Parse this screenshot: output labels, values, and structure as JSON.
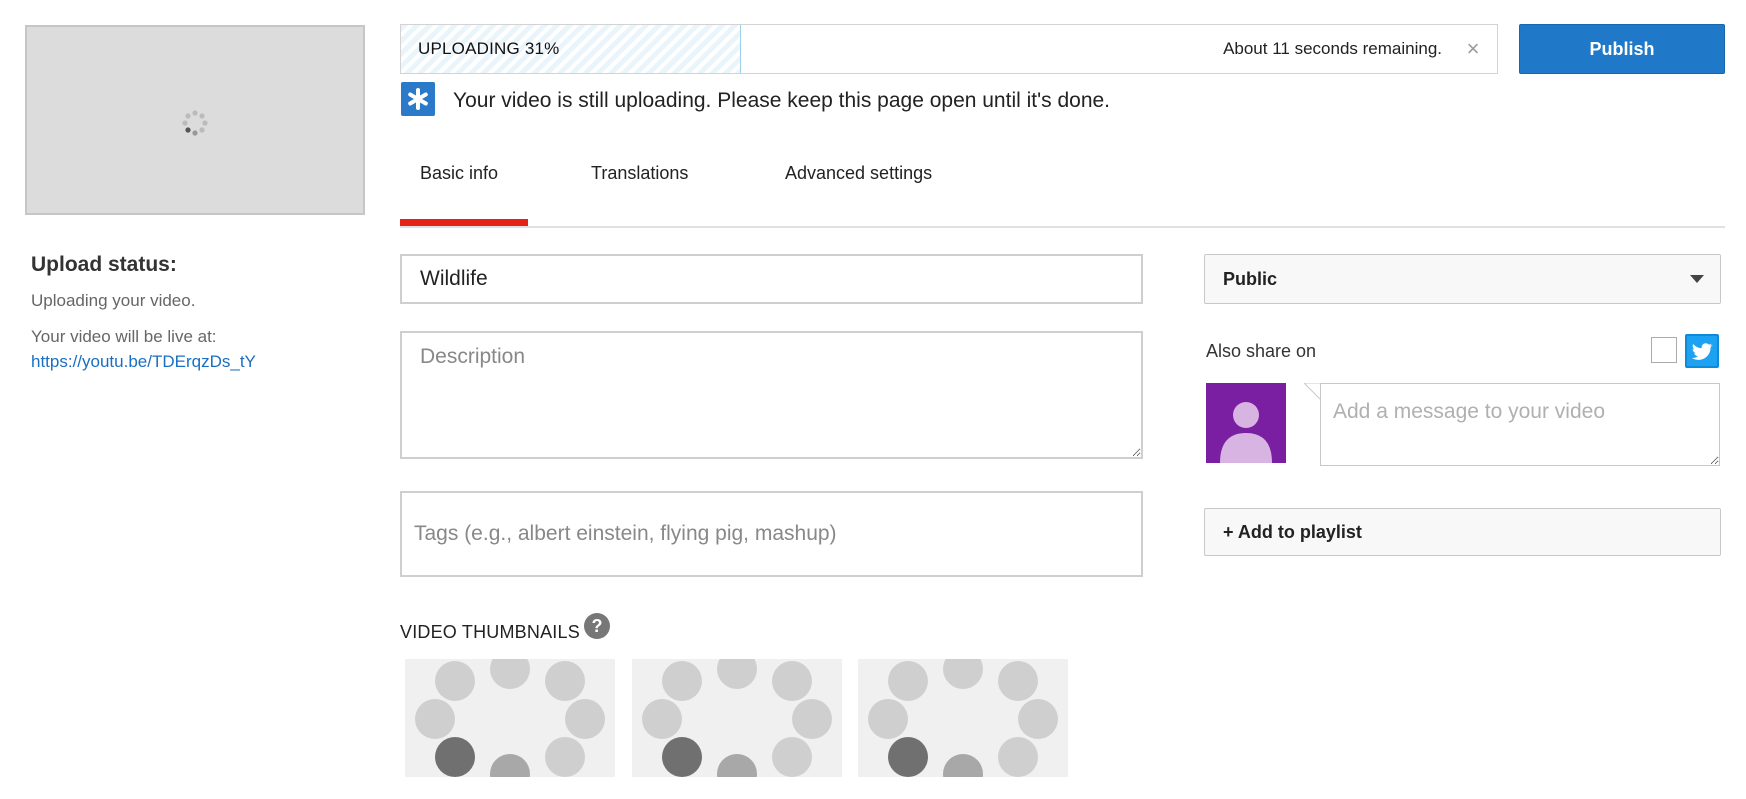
{
  "sidebar": {
    "upload_status_title": "Upload status:",
    "upload_status_text": "Uploading your video.",
    "live_label": "Your video will be live at:",
    "video_link": "https://youtu.be/TDErqzDs_tY"
  },
  "upload": {
    "progress_label": "UPLOADING 31%",
    "progress": 0.31,
    "remaining_text": "About 11 seconds remaining.",
    "publish_label": "Publish",
    "notice_text": "Your video is still uploading. Please keep this page open until it's done."
  },
  "tabs": [
    {
      "label": "Basic info",
      "active": true
    },
    {
      "label": "Translations",
      "active": false
    },
    {
      "label": "Advanced settings",
      "active": false
    }
  ],
  "form": {
    "title_value": "Wildlife",
    "description_placeholder": "Description",
    "tags_placeholder": "Tags (e.g., albert einstein, flying pig, mashup)"
  },
  "thumbnails": {
    "title": "VIDEO THUMBNAILS",
    "help_glyph": "?"
  },
  "right": {
    "privacy_value": "Public",
    "share_label": "Also share on",
    "message_placeholder": "Add a message to your video",
    "add_playlist_label": "+ Add to playlist"
  },
  "colors": {
    "accent": "#1f79c8",
    "tab_active": "#e62117",
    "twitter": "#1da1f2",
    "avatar_bg": "#7b1fa2"
  },
  "icons": {
    "spinner": "loading-spinner-icon",
    "cancel": "close-icon",
    "notice": "star-icon",
    "help": "help-icon",
    "twitter": "twitter-icon",
    "privacy_caret": "chevron-down-icon"
  }
}
